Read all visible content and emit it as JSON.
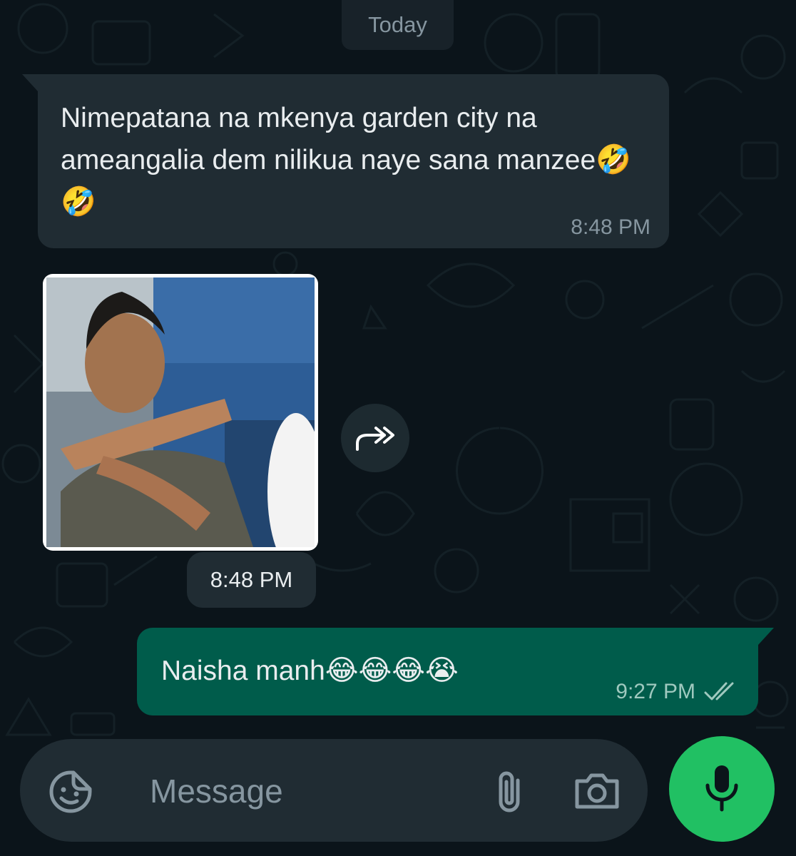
{
  "chat": {
    "date_separator": "Today",
    "messages": [
      {
        "direction": "incoming",
        "text_parts": [
          "Nimepatana na mkenya garden city na ameangalia dem nilikua naye sana manzee",
          "🤣🤣"
        ],
        "time": "8:48 PM"
      },
      {
        "direction": "incoming",
        "type": "sticker",
        "time": "8:48 PM"
      },
      {
        "direction": "outgoing",
        "text_parts": [
          "Naisha manh",
          "😂😂😂😭"
        ],
        "time": "9:27 PM",
        "status": "double-check-read-icon"
      }
    ]
  },
  "composer": {
    "placeholder": "Message",
    "icons": [
      "sticker-icon",
      "attach-icon",
      "camera-icon",
      "mic-icon"
    ]
  },
  "colors": {
    "background": "#0b141a",
    "incoming_bubble": "#202c33",
    "outgoing_bubble": "#005c4b",
    "mic_button": "#21c063",
    "cursor": "#25d366"
  }
}
